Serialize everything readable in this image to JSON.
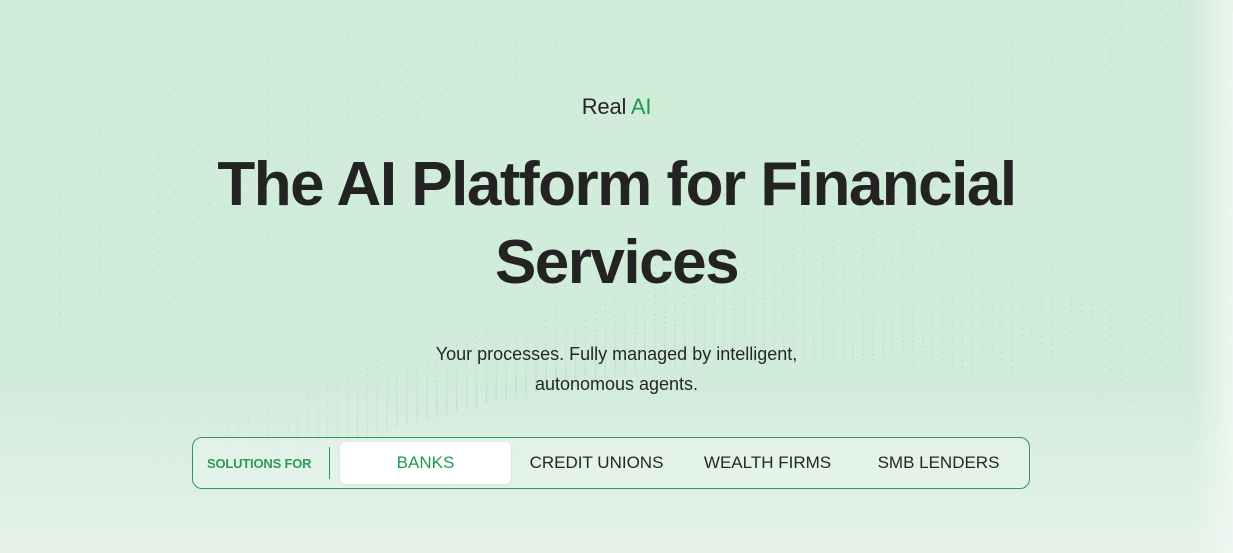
{
  "hero": {
    "eyebrow_prefix": "Real",
    "eyebrow_accent": "AI",
    "title": "The AI Platform for Financial Services",
    "subtitle_line1": "Your processes. Fully managed by intelligent,",
    "subtitle_line2": "autonomous agents."
  },
  "solutions": {
    "label": "SOLUTIONS FOR",
    "tabs": [
      {
        "label": "BANKS",
        "active": true
      },
      {
        "label": "CREDIT UNIONS",
        "active": false
      },
      {
        "label": "WEALTH FIRMS",
        "active": false
      },
      {
        "label": "SMB LENDERS",
        "active": false
      }
    ]
  },
  "colors": {
    "accent": "#1f9a4d",
    "background": "#d2ecdc",
    "text": "#232323"
  }
}
